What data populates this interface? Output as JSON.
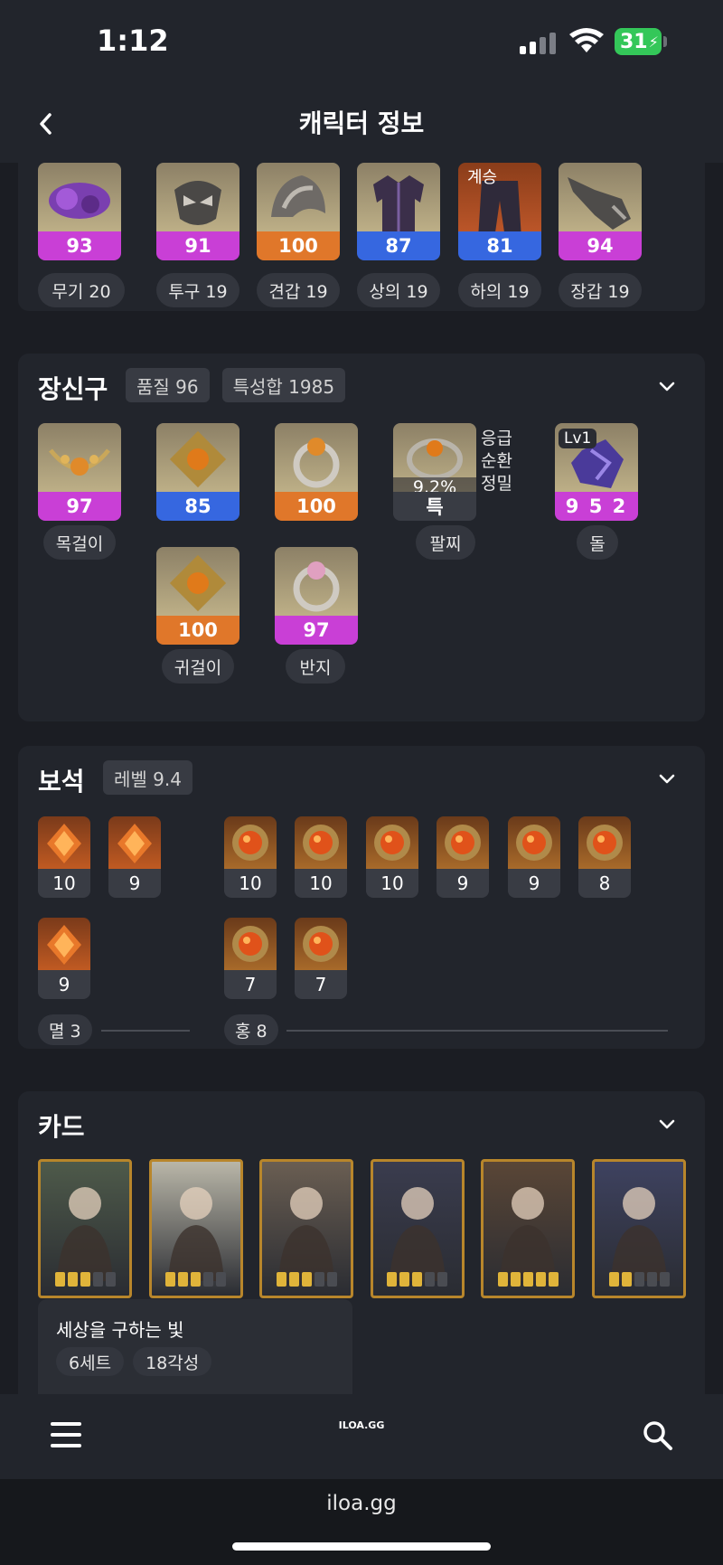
{
  "status": {
    "time": "1:12",
    "battery": "31"
  },
  "nav": {
    "title": "캐릭터 정보"
  },
  "equipment": {
    "items": [
      {
        "quality": "93",
        "label": "무기 20",
        "bar": "#c93fd6",
        "tint": "#6a2d8c",
        "overlay": ""
      },
      {
        "quality": "91",
        "label": "투구 19",
        "bar": "#c93fd6",
        "tint": "#6e6c6a",
        "overlay": ""
      },
      {
        "quality": "100",
        "label": "견갑 19",
        "bar": "#e0772a",
        "tint": "#7a7876",
        "overlay": ""
      },
      {
        "quality": "87",
        "label": "상의 19",
        "bar": "#3667e0",
        "tint": "#3b2f4a",
        "overlay": ""
      },
      {
        "quality": "81",
        "label": "하의 19",
        "bar": "#3667e0",
        "tint": "#2f2a3a",
        "overlay": "계승"
      },
      {
        "quality": "94",
        "label": "장갑 19",
        "bar": "#c93fd6",
        "tint": "#5a5856",
        "overlay": ""
      }
    ]
  },
  "accessories": {
    "title": "장신구",
    "quality_tag": "품질 96",
    "stats_tag": "특성합 1985",
    "items": [
      {
        "id": "necklace",
        "quality": "97",
        "label": "목걸이",
        "bar": "#c93fd6"
      },
      {
        "id": "earring1",
        "quality": "85",
        "label": "",
        "bar": "#3667e0"
      },
      {
        "id": "ring1",
        "quality": "100",
        "label": "",
        "bar": "#e0772a"
      },
      {
        "id": "earring2",
        "quality": "100",
        "label": "귀걸이",
        "bar": "#e0772a"
      },
      {
        "id": "ring2",
        "quality": "97",
        "label": "반지",
        "bar": "#c93fd6"
      }
    ],
    "bracelet": {
      "percent": "9.2%",
      "grade": "특",
      "effects": [
        "응급",
        "순환",
        "정밀"
      ],
      "label": "팔찌"
    },
    "stone": {
      "level": "Lv1",
      "value": "9 5 2",
      "label": "돌"
    }
  },
  "gems": {
    "title": "보석",
    "level_tag": "레벨 9.4",
    "left": [
      "10",
      "9",
      "9"
    ],
    "right": [
      "10",
      "10",
      "10",
      "9",
      "9",
      "8",
      "7",
      "7"
    ],
    "left_summary": "멸 3",
    "right_summary": "홍 8"
  },
  "cards": {
    "title": "카드",
    "set_name": "세상을 구하는 빛",
    "set_count": "6세트",
    "awakening": "18각성",
    "awakened": [
      3,
      3,
      3,
      3,
      5,
      2
    ],
    "colors": [
      "#4e5a4a",
      "#b9b6a8",
      "#6a5e52",
      "#3a3c4e",
      "#5a4636",
      "#3e4260"
    ]
  },
  "footer": {
    "logo": "ILOA.GG",
    "url": "iloa.gg"
  }
}
